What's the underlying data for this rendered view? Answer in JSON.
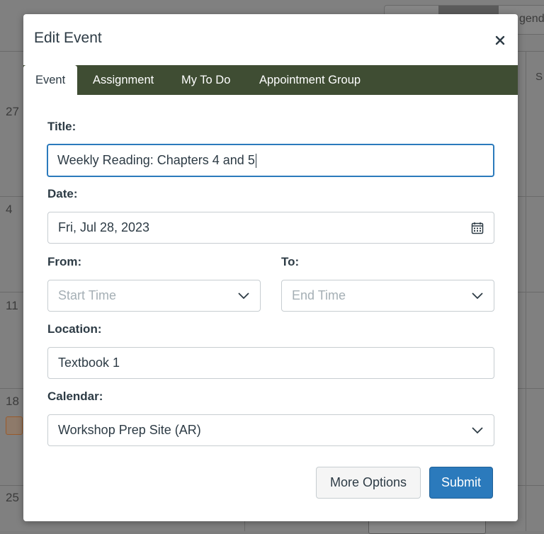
{
  "background": {
    "toolbar_partial_text": "genda",
    "day_numbers": [
      "27",
      "4",
      "11",
      "18",
      "25"
    ],
    "right_edge_letter": "S"
  },
  "modal": {
    "title": "Edit Event",
    "close_icon": "close-icon",
    "tabs": [
      {
        "label": "Event",
        "active": true
      },
      {
        "label": "Assignment",
        "active": false
      },
      {
        "label": "My To Do",
        "active": false
      },
      {
        "label": "Appointment Group",
        "active": false
      }
    ],
    "form": {
      "title_label": "Title:",
      "title_value": "Weekly Reading: Chapters 4 and 5",
      "date_label": "Date:",
      "date_value": "Fri, Jul 28, 2023",
      "from_label": "From:",
      "from_placeholder": "Start Time",
      "to_label": "To:",
      "to_placeholder": "End Time",
      "location_label": "Location:",
      "location_value": "Textbook 1",
      "calendar_label": "Calendar:",
      "calendar_value": "Workshop Prep Site (AR)"
    },
    "buttons": {
      "more_options": "More Options",
      "submit": "Submit"
    }
  },
  "colors": {
    "tab_bar": "#3f4d33",
    "primary": "#2b7abc",
    "text": "#2d3b45",
    "border": "#c7cdd1",
    "placeholder": "#a5afb5"
  }
}
